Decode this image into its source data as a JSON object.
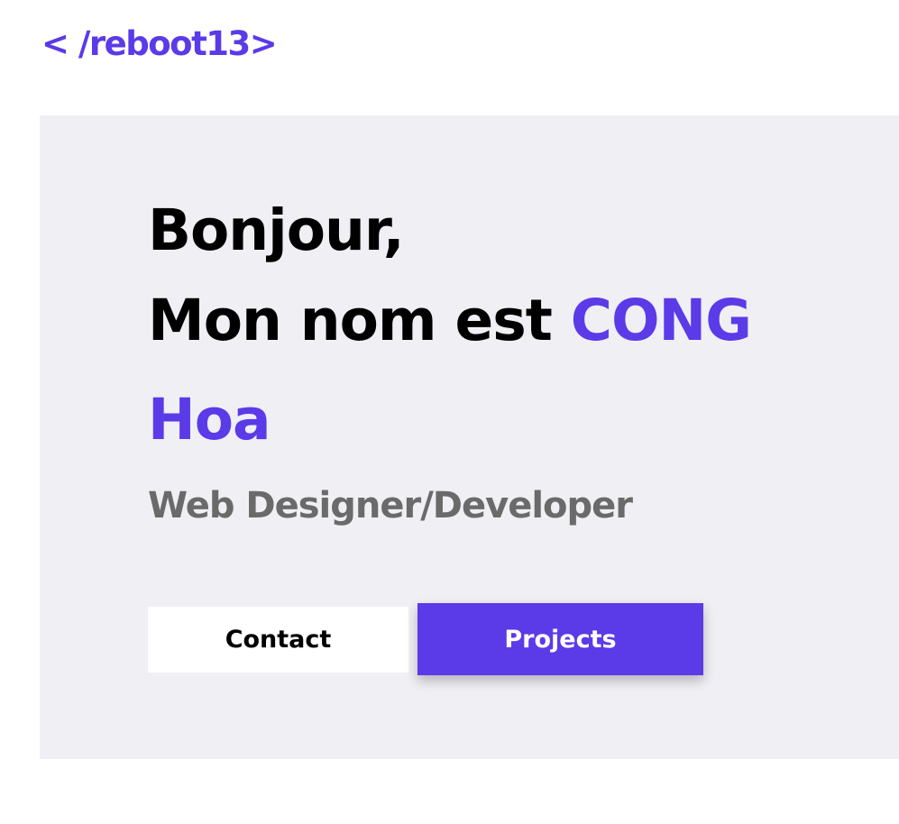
{
  "brand": {
    "logo_text": "< /reboot13>",
    "accent_color": "#5b3ae8"
  },
  "hero": {
    "greeting": "Bonjour,",
    "name_prefix": "Mon nom est ",
    "name_first": "CONG",
    "name_last": "Hoa",
    "subtitle": "Web Designer/Developer",
    "background_color": "#efeff4"
  },
  "buttons": {
    "contact_label": "Contact",
    "projects_label": "Projects"
  }
}
